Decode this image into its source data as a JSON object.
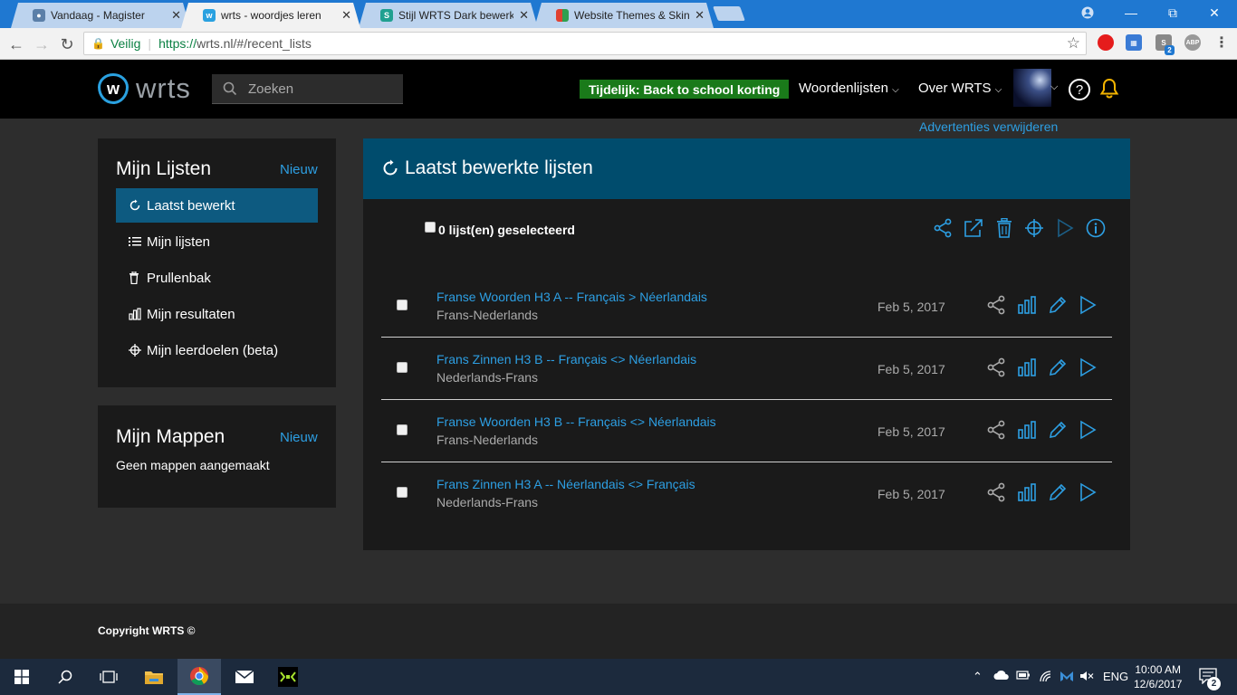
{
  "browser": {
    "tabs": [
      {
        "title": "Vandaag - Magister",
        "icon": "people-icon",
        "color": "#5b7fa8",
        "active": false
      },
      {
        "title": "wrts - woordjes leren",
        "icon": "wrts-icon",
        "color": "#2aa1e0",
        "active": true
      },
      {
        "title": "Stijl WRTS Dark bewerken",
        "icon": "stylish-icon",
        "color": "#20a090",
        "active": false
      },
      {
        "title": "Website Themes & Skins",
        "icon": "themes-icon",
        "color": "#e0a030",
        "active": false
      }
    ],
    "security_label": "Veilig",
    "url_scheme": "https://",
    "url_rest": "wrts.nl/#/recent_lists",
    "extension_badge": "2"
  },
  "header": {
    "logo_text": "wrts",
    "logo_letter": "w",
    "search_placeholder": "Zoeken",
    "promo": "Tijdelijk: Back to school korting",
    "nav_lists": "Woordenlijsten",
    "nav_about": "Over WRTS",
    "remove_ads": "Advertenties verwijderen"
  },
  "sidebar": {
    "lists_title": "Mijn Lijsten",
    "lists_new": "Nieuw",
    "items": [
      {
        "label": "Laatst bewerkt",
        "icon": "refresh-icon",
        "active": true
      },
      {
        "label": "Mijn lijsten",
        "icon": "list-icon",
        "active": false
      },
      {
        "label": "Prullenbak",
        "icon": "trash-icon",
        "active": false
      },
      {
        "label": "Mijn resultaten",
        "icon": "bar-chart-icon",
        "active": false
      },
      {
        "label": "Mijn leerdoelen (beta)",
        "icon": "target-icon",
        "active": false
      }
    ],
    "folders_title": "Mijn Mappen",
    "folders_new": "Nieuw",
    "folders_empty": "Geen mappen aangemaakt"
  },
  "main": {
    "title": "Laatst bewerkte lijsten",
    "selected_count": "0 lijst(en) geselecteerd",
    "lists": [
      {
        "title": "Franse Woorden H3 A -- Français > Néerlandais",
        "languages": "Frans-Nederlands",
        "date": "Feb 5, 2017"
      },
      {
        "title": "Frans Zinnen H3 B -- Français <> Néerlandais",
        "languages": "Nederlands-Frans",
        "date": "Feb 5, 2017"
      },
      {
        "title": "Franse Woorden H3 B -- Français <> Néerlandais",
        "languages": "Frans-Nederlands",
        "date": "Feb 5, 2017"
      },
      {
        "title": "Frans Zinnen H3 A -- Néerlandais <> Français",
        "languages": "Nederlands-Frans",
        "date": "Feb 5, 2017"
      }
    ]
  },
  "footer": {
    "copyright": "Copyright WRTS ©"
  },
  "taskbar": {
    "language": "ENG",
    "time": "10:00 AM",
    "date": "12/6/2017",
    "notifications": "2"
  },
  "colors": {
    "accent": "#2d9fe3",
    "header_bar": "#004c6d",
    "active_item": "#0d5a80",
    "promo": "#1a7a1a",
    "bell": "#f3b300"
  }
}
